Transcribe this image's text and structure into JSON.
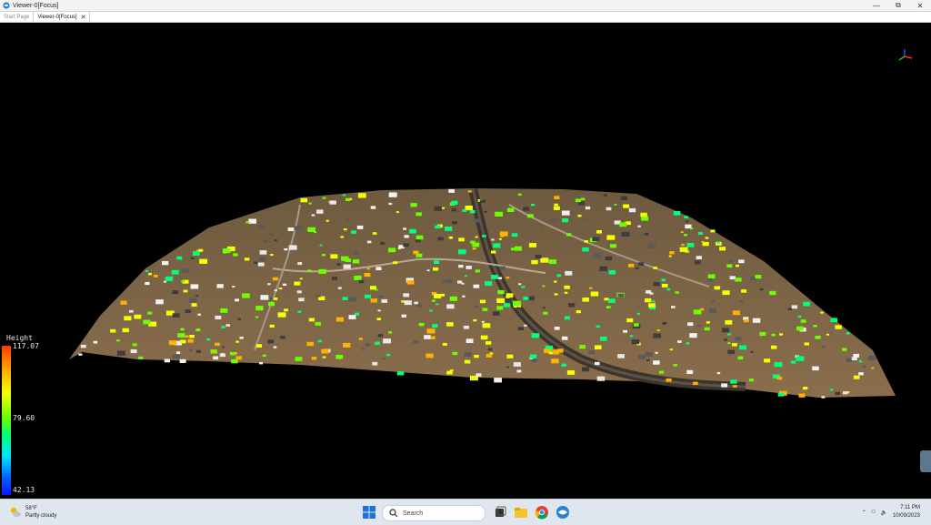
{
  "window": {
    "title": "Viewer-0[Focus]"
  },
  "tabs": [
    {
      "label": "Start Page",
      "active": false
    },
    {
      "label": "Viewer-0[Focus]",
      "active": true
    }
  ],
  "legend": {
    "title": "Height",
    "max": "117.07",
    "mid": "79.60",
    "min": "42.13",
    "colors": [
      "#ff3a00",
      "#ffb300",
      "#f4ff00",
      "#6cff00",
      "#00ff7a",
      "#00e5ff",
      "#0066ff",
      "#0a14ff"
    ]
  },
  "taskbar": {
    "weather_temp": "58°F",
    "weather_desc": "Partly cloudy",
    "search_label": "Search",
    "time": "7:11 PM",
    "date": "10/09/2023"
  }
}
